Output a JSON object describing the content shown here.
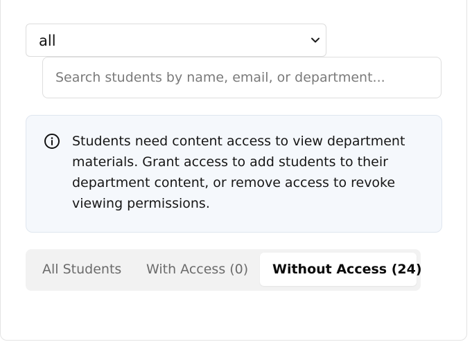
{
  "filter": {
    "selected_value": "all"
  },
  "search": {
    "placeholder": "Search students by name, email, or department..."
  },
  "notice": {
    "text": "Students need content access to view department materials. Grant access to add students to their department content, or remove access to revoke viewing permissions.",
    "icon": "info-icon"
  },
  "tabs": [
    {
      "label": "All Students",
      "active": false
    },
    {
      "label": "With Access (0)",
      "active": false
    },
    {
      "label": "Without Access (24)",
      "active": true
    }
  ],
  "colors": {
    "notice_background": "#f5f8fc",
    "tabs_background": "#f2f2f2",
    "active_tab": "#ffffff"
  }
}
